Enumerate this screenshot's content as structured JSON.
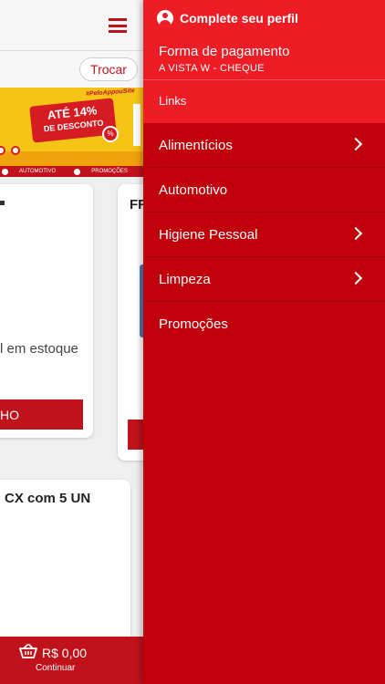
{
  "background": {
    "store_button": "Trocar",
    "banner": {
      "hashtag": "#PeloAppouSite",
      "promo_line1": "ATÉ 14%",
      "promo_line2": "DE DESCONTO"
    },
    "category_strip": [
      "AUTOMOTIVO",
      "PROMOÇÕES"
    ],
    "products": [
      {
        "title": "",
        "stock": "l em estoque",
        "button_fragment": "HO"
      },
      {
        "title": "FF",
        "stock": "",
        "button_fragment": ""
      },
      {
        "title": "CX com 5 UN",
        "stock": "",
        "button_fragment": ""
      }
    ],
    "cart": {
      "total": "R$ 0,00",
      "continue_label": "Continuar"
    }
  },
  "drawer": {
    "profile_label": "Complete seu perfil",
    "payment_label": "Forma de pagamento",
    "payment_value": "A VISTA W - CHEQUE",
    "links_label": "Links",
    "menu": [
      {
        "label": "Alimentícios",
        "has_submenu": true
      },
      {
        "label": "Automotivo",
        "has_submenu": false
      },
      {
        "label": "Higiene Pessoal",
        "has_submenu": true
      },
      {
        "label": "Limpeza",
        "has_submenu": true
      },
      {
        "label": "Promoções",
        "has_submenu": false
      }
    ]
  },
  "colors": {
    "brand_red": "#c0000a",
    "header_red": "#ee1c25",
    "banner_yellow": "#f6c416"
  }
}
